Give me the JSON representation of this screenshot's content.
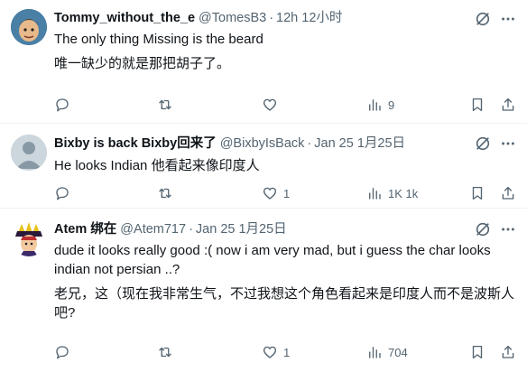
{
  "tweets": [
    {
      "name": "Tommy_without_the_e",
      "handle": "@TomesB3",
      "time": "12h 12小时",
      "lines": [
        "The only thing Missing is the beard",
        "唯一缺少的就是那把胡子了。"
      ],
      "replies": "",
      "retweets": "",
      "likes": "",
      "views": "9"
    },
    {
      "name": "Bixby is back Bixby回来了",
      "handle": "@BixbyIsBack",
      "time": "Jan 25 1月25日",
      "lines": [
        "He looks Indian  他看起来像印度人"
      ],
      "replies": "",
      "retweets": "",
      "likes": "1",
      "views": "1K 1k"
    },
    {
      "name": "Atem 绑在",
      "handle": "@Atem717",
      "time": "Jan 25 1月25日",
      "lines": [
        "dude it looks really good :( now i am very mad, but i guess the char looks",
        "indian not persian ..?",
        "老兄，这（现在我非常生气，不过我想这个角色看起来是印度人而不是波斯人",
        "吧?"
      ],
      "replies": "",
      "retweets": "",
      "likes": "1",
      "views": "704"
    }
  ],
  "separator": "·",
  "colors": {
    "text": "#0f1419",
    "secondary": "#536471",
    "divider": "#eff3f4"
  },
  "icons": [
    "reply-icon",
    "retweet-icon",
    "like-icon",
    "views-icon",
    "bookmark-icon",
    "share-icon",
    "grok-icon",
    "more-icon"
  ]
}
